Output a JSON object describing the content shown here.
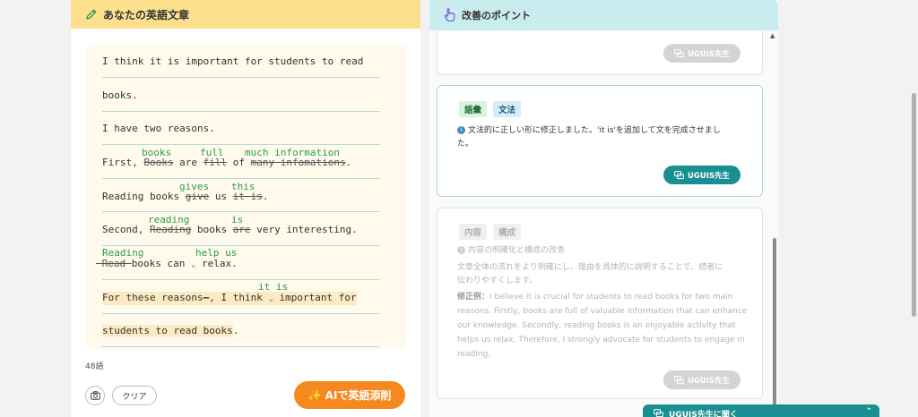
{
  "left": {
    "title": "あなたの英語文章",
    "essay": {
      "l1": "I think it is important for students to read",
      "l2": "books.",
      "l3": "I have two reasons.",
      "l4a": "First, ",
      "l4b": "Books",
      "l4c": " are ",
      "l4d": "fill",
      "l4e": " of ",
      "l4f": "many infomations",
      "l4g": ".",
      "c4a": "books",
      "c4b": "full",
      "c4c": "much information",
      "l5a": "Reading books ",
      "l5b": "give",
      "l5c": " us ",
      "l5d": "it is",
      "l5e": ".",
      "c5a": "gives",
      "c5b": "this",
      "l6a": "Second, ",
      "l6b": "Reading",
      "l6c": " books ",
      "l6d": "are",
      "l6e": " very interesting.",
      "c6a": "reading",
      "c6b": "is",
      "l7a": " Read ",
      "l7b": "books can ",
      "l7c": " relax.",
      "c7a": "Reading",
      "c7b": "help us",
      "l8a": "For these reasons",
      "l8b": "—",
      "l8c": ", I think ",
      "l8d": " important for",
      "c8a": "it is",
      "l9a": "students to read books",
      "l9b": "."
    },
    "caret": "⌄",
    "word_count": "48語",
    "clear_label": "クリア",
    "ai_button": "✨ AIで英語添削"
  },
  "right": {
    "title": "改善のポイント",
    "uguis_label": "UGUIS先生",
    "card2": {
      "tag1": "語彙",
      "tag2": "文法",
      "text1": "文法的に正しい形に修正しました。'it is'を追加して文を完成させまし",
      "text2": "た。"
    },
    "card3": {
      "tag1": "内容",
      "tag2": "構成",
      "heading": "内容の明確化と構成の改善",
      "desc1": "文章全体の流れをより明確にし、理由を具体的に説明することで、読者に",
      "desc2": "伝わりやすくします。",
      "ex_label": "修正例：",
      "ex1": "I believe it is crucial for students to read books for two main",
      "ex2": "reasons. Firstly, books are full of valuable information that can enhance",
      "ex3": "our knowledge. Secondly, reading books is an enjoyable activity that",
      "ex4": "helps us relax. Therefore, I strongly advocate for students to engage in",
      "ex5": "reading."
    }
  },
  "float_bar": {
    "label": "UGUIS先生に聞く",
    "chev": "⌃"
  },
  "colors": {
    "header_yellow": "#fde08e",
    "header_teal": "#c9ecef",
    "accent_orange": "#f5891f",
    "accent_teal": "#1a8f91",
    "correction_green": "#2e9b4e"
  }
}
